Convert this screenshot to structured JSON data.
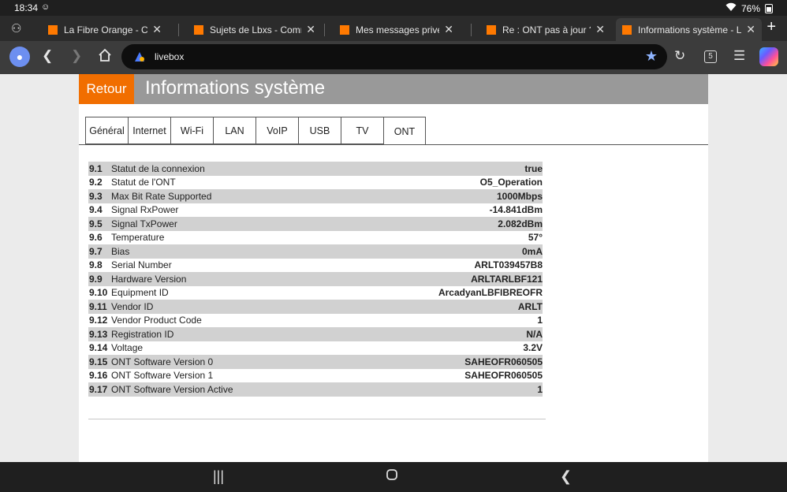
{
  "status_bar": {
    "time": "18:34",
    "battery": "76%"
  },
  "tabs": [
    {
      "title": "La Fibre Orange - Communauté Orange"
    },
    {
      "title": "Sujets de Lbxs - Communauté"
    },
    {
      "title": "Mes messages privés - Communauté"
    },
    {
      "title": "Re : ONT pas à jour ? - Communauté"
    },
    {
      "title": "Informations système - Livebox"
    }
  ],
  "toolbar": {
    "url": "livebox",
    "tab_count": "5"
  },
  "page": {
    "back_label": "Retour",
    "title": "Informations système",
    "subtabs": [
      "Général",
      "Internet",
      "Wi-Fi",
      "LAN",
      "VoIP",
      "USB",
      "TV",
      "ONT"
    ],
    "active_subtab": "ONT",
    "rows": [
      {
        "num": "9.1",
        "label": "Statut de la connexion",
        "value": "true"
      },
      {
        "num": "9.2",
        "label": "Statut de l'ONT",
        "value": "O5_Operation"
      },
      {
        "num": "9.3",
        "label": "Max Bit Rate Supported",
        "value": "1000Mbps"
      },
      {
        "num": "9.4",
        "label": "Signal RxPower",
        "value": "-14.841dBm"
      },
      {
        "num": "9.5",
        "label": "Signal TxPower",
        "value": "2.082dBm"
      },
      {
        "num": "9.6",
        "label": "Temperature",
        "value": "57°"
      },
      {
        "num": "9.7",
        "label": "Bias",
        "value": "0mA"
      },
      {
        "num": "9.8",
        "label": "Serial Number",
        "value": "ARLT039457B8"
      },
      {
        "num": "9.9",
        "label": "Hardware Version",
        "value": "ARLTARLBF121"
      },
      {
        "num": "9.10",
        "label": "Equipment ID",
        "value": "ArcadyanLBFIBREOFR"
      },
      {
        "num": "9.11",
        "label": "Vendor ID",
        "value": "ARLT"
      },
      {
        "num": "9.12",
        "label": "Vendor Product Code",
        "value": "1"
      },
      {
        "num": "9.13",
        "label": "Registration ID",
        "value": "N/A"
      },
      {
        "num": "9.14",
        "label": "Voltage",
        "value": "3.2V"
      },
      {
        "num": "9.15",
        "label": "ONT Software Version 0",
        "value": "SAHEOFR060505"
      },
      {
        "num": "9.16",
        "label": "ONT Software Version 1",
        "value": "SAHEOFR060505"
      },
      {
        "num": "9.17",
        "label": "ONT Software Version Active",
        "value": "1"
      }
    ]
  },
  "colors": {
    "orange": "#f16e00",
    "header_gray": "#999999",
    "row_stripe": "#d1d1d1"
  }
}
